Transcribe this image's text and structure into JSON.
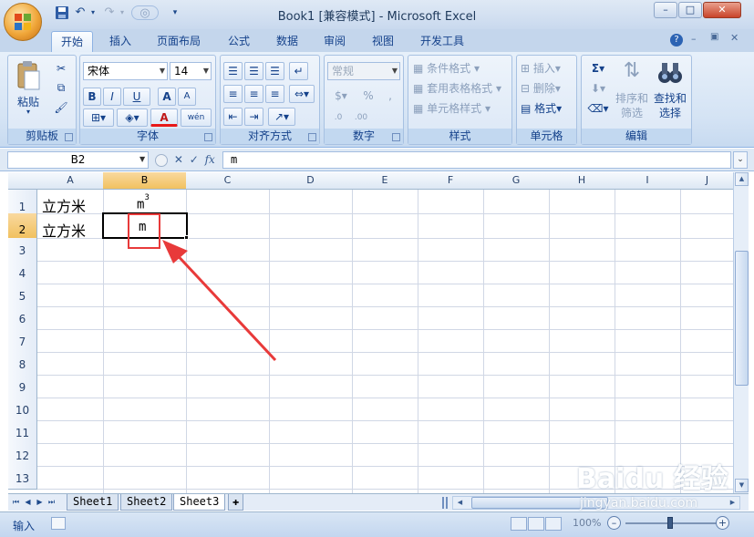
{
  "window": {
    "title": "Book1  [兼容模式] - Microsoft Excel",
    "minimize_label": "–",
    "maximize_label": "□",
    "close_label": "✕"
  },
  "qat": {
    "save_icon": "save-icon",
    "undo_icon": "undo-icon",
    "redo_icon": "redo-icon",
    "camera_icon": "camera-icon",
    "customize_icon": "chevron-down-icon"
  },
  "tabs": [
    "开始",
    "插入",
    "页面布局",
    "公式",
    "数据",
    "审阅",
    "视图",
    "开发工具"
  ],
  "ribbon": {
    "clipboard": {
      "label": "剪贴板",
      "paste_label": "粘贴"
    },
    "font": {
      "label": "字体",
      "font_name": "宋体",
      "font_size": "14",
      "bold": "B",
      "italic": "I",
      "underline": "U",
      "grow": "A",
      "shrink": "A",
      "font_color": "A",
      "phonetic": "wén"
    },
    "alignment": {
      "label": "对齐方式"
    },
    "number": {
      "label": "数字",
      "format": "常规",
      "percent": "%",
      "comma": ","
    },
    "styles": {
      "label": "样式",
      "conditional": "条件格式",
      "table_format": "套用表格格式",
      "cell_styles": "单元格样式"
    },
    "cells": {
      "label": "单元格",
      "insert": "插入",
      "delete": "删除",
      "format": "格式"
    },
    "editing": {
      "label": "编辑",
      "sum": "Σ",
      "sort_filter_line1": "排序和",
      "sort_filter_line2": "筛选",
      "find_select_line1": "查找和",
      "find_select_line2": "选择"
    }
  },
  "formula_bar": {
    "name_box": "B2",
    "fx": "fx",
    "cancel": "✕",
    "enter": "✓",
    "content": "m"
  },
  "columns": [
    "A",
    "B",
    "C",
    "D",
    "E",
    "F",
    "G",
    "H",
    "I",
    "J"
  ],
  "rows": [
    "1",
    "2",
    "3",
    "4",
    "5",
    "6",
    "7",
    "8",
    "9",
    "10",
    "11",
    "12",
    "13"
  ],
  "cells": {
    "A1": "立方米",
    "A2": "立方米",
    "B1_base": "m",
    "B1_sup": "3",
    "B2": "m"
  },
  "sheets": [
    "Sheet1",
    "Sheet2",
    "Sheet3"
  ],
  "active_sheet": "Sheet3",
  "status": {
    "mode": "输入",
    "zoom": "100%"
  },
  "watermark": {
    "brand": "Baidu 经验",
    "url": "jingyan.baidu.com"
  },
  "colors": {
    "selection_header": "#f1c15f",
    "annotation": "#e83a3a"
  }
}
